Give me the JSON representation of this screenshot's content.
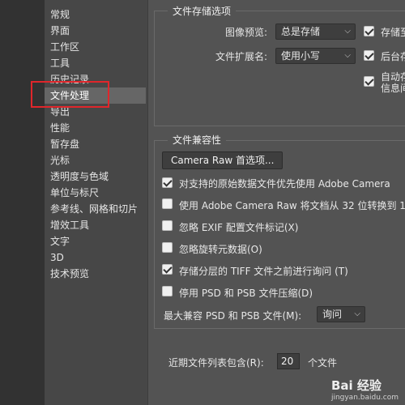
{
  "sidebar": {
    "items": [
      {
        "label": "常规"
      },
      {
        "label": "界面"
      },
      {
        "label": "工作区"
      },
      {
        "label": "工具"
      },
      {
        "label": "历史记录"
      },
      {
        "label": "文件处理"
      },
      {
        "label": "导出"
      },
      {
        "label": "性能"
      },
      {
        "label": "暂存盘"
      },
      {
        "label": "光标"
      },
      {
        "label": "透明度与色域"
      },
      {
        "label": "单位与标尺"
      },
      {
        "label": "参考线、网格和切片"
      },
      {
        "label": "增效工具"
      },
      {
        "label": "文字"
      },
      {
        "label": "3D"
      },
      {
        "label": "技术预览"
      }
    ]
  },
  "storage": {
    "title": "文件存储选项",
    "preview_label": "图像预览:",
    "preview_value": "总是存储",
    "ext_label": "文件扩展名:",
    "ext_value": "使用小写",
    "cb1_label": "存储至",
    "cb2_label": "后台存",
    "cb3_label_line1": "自动存",
    "cb3_label_line2": "信息间"
  },
  "compat": {
    "title": "文件兼容性",
    "camera_raw_button": "Camera Raw 首选项...",
    "options": [
      {
        "label": "对支持的原始数据文件优先使用 Adobe Camera",
        "checked": true
      },
      {
        "label": "使用 Adobe Camera Raw 将文档从 32 位转换到 1",
        "checked": false
      },
      {
        "label": "忽略 EXIF 配置文件标记(X)",
        "checked": false
      },
      {
        "label": "忽略旋转元数据(O)",
        "checked": false
      },
      {
        "label": "存储分层的 TIFF 文件之前进行询问 (T)",
        "checked": true
      },
      {
        "label": "停用 PSD 和 PSB 文件压缩(D)",
        "checked": false
      }
    ],
    "max_compat_label": "最大兼容 PSD 和 PSB 文件(M):",
    "max_compat_value": "询问"
  },
  "recent": {
    "label": "近期文件列表包含(R):",
    "value": "20",
    "unit": "个文件"
  },
  "watermark": {
    "text": "Bai 经验",
    "sub": "jingyan.baidu.com"
  }
}
